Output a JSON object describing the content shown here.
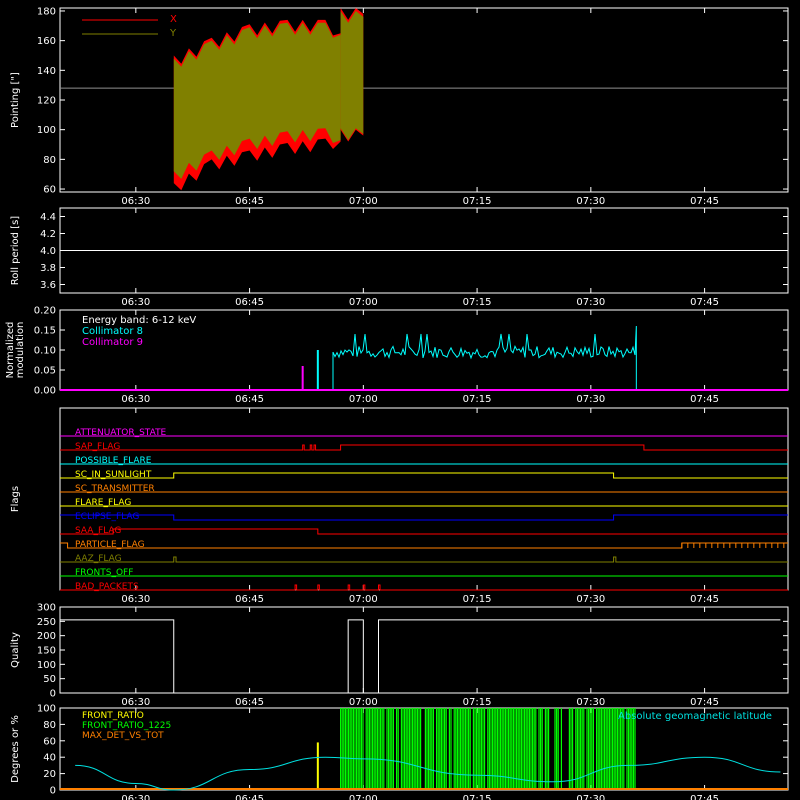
{
  "colors": {
    "background": "#000000",
    "axis": "#ffffff",
    "x_series": "#ff0000",
    "y_series": "#808000",
    "collimator8": "#00ffff",
    "collimator9": "#ff00ff",
    "front_ratio": "#ffff00",
    "front_ratio_1225": "#00ff00",
    "max_det": "#ff8000",
    "geomag": "#00e0e0"
  },
  "time_ticks": [
    "06:30",
    "06:45",
    "07:00",
    "07:15",
    "07:30",
    "07:45"
  ],
  "chart_data": [
    {
      "id": "pointing",
      "type": "area",
      "ylabel": "Pointing [\"]",
      "ylim": [
        58,
        182
      ],
      "yticks": [
        "60",
        "80",
        "100",
        "120",
        "140",
        "160",
        "180"
      ],
      "legend": {
        "position": "top-left",
        "entries": [
          "X",
          "Y"
        ]
      },
      "reference_line": 128,
      "series": [
        {
          "name": "X",
          "color": "#ff0000",
          "segments": [
            {
              "t": [
                "06:35",
                "06:40",
                "06:45",
                "06:50",
                "06:55",
                "06:57"
              ],
              "low": [
                60,
                76,
                82,
                87,
                90,
                92
              ],
              "high": [
                146,
                158,
                167,
                170,
                170,
                165
              ]
            },
            {
              "t": [
                "06:57",
                "07:00"
              ],
              "low": [
                96,
                96
              ],
              "high": [
                178,
                178
              ]
            }
          ]
        },
        {
          "name": "Y",
          "color": "#808000",
          "segments": [
            {
              "t": [
                "06:35",
                "06:40",
                "06:45",
                "06:50",
                "06:55",
                "06:57"
              ],
              "low": [
                68,
                82,
                90,
                95,
                97,
                93
              ],
              "high": [
                144,
                156,
                165,
                168,
                168,
                164
              ]
            },
            {
              "t": [
                "06:57",
                "07:00"
              ],
              "low": [
                97,
                97
              ],
              "high": [
                176,
                176
              ]
            }
          ]
        }
      ]
    },
    {
      "id": "roll",
      "type": "line",
      "ylabel": "Roll period [s]",
      "ylim": [
        3.5,
        4.5
      ],
      "yticks": [
        "3.6",
        "3.8",
        "4.0",
        "4.2",
        "4.4"
      ],
      "value": 4.0
    },
    {
      "id": "modulation",
      "type": "bar",
      "ylabel_lines": [
        "Normalized",
        "modulation"
      ],
      "ylim": [
        0,
        0.2
      ],
      "yticks": [
        "0.00",
        "0.05",
        "0.10",
        "0.15",
        "0.20"
      ],
      "annotations": [
        "Energy band: 6-12 keV",
        "Collimator 8",
        "Collimator 9"
      ],
      "spikes": [
        {
          "t": "06:52",
          "value": 0.06,
          "series": "Collimator 9"
        },
        {
          "t": "06:54",
          "value": 0.1,
          "series": "Collimator 8"
        }
      ],
      "band": {
        "series": "Collimator 8",
        "t_start": "06:56",
        "t_end": "07:36",
        "mean": 0.095,
        "spread": 0.015
      }
    },
    {
      "id": "flags",
      "type": "line",
      "ylabel": "Flags",
      "rows": [
        {
          "name": "ATTENUATOR_STATE",
          "color": "#ff00ff",
          "default": 0,
          "pulses": []
        },
        {
          "name": "SAP_FLAG",
          "color": "#ff0000",
          "default": 0,
          "pulses": [
            [
              "06:52",
              "06:52.2"
            ],
            [
              "06:53",
              "06:53.2"
            ],
            [
              "06:53.5",
              "06:53.7"
            ],
            [
              "06:57",
              "07:37"
            ]
          ],
          "invert_pulses": true
        },
        {
          "name": "POSSIBLE_FLARE",
          "color": "#00ffff",
          "default": 0,
          "pulses": []
        },
        {
          "name": "SC_IN_SUNLIGHT",
          "color": "#ffff00",
          "default": 0,
          "pulses": [
            [
              "06:35",
              "07:33"
            ]
          ]
        },
        {
          "name": "SC_TRANSMITTER",
          "color": "#ff8000",
          "default": 0,
          "pulses": []
        },
        {
          "name": "FLARE_FLAG",
          "color": "#ffff00",
          "default": 0,
          "pulses": []
        },
        {
          "name": "ECLIPSE_FLAG",
          "color": "#0000ff",
          "default": 1,
          "pulses": [
            [
              "06:35",
              "07:33"
            ]
          ],
          "invert_pulses": true
        },
        {
          "name": "SAA_FLAG",
          "color": "#ff0000",
          "default": 0,
          "pulses": [
            [
              "06:27",
              "06:54"
            ]
          ]
        },
        {
          "name": "PARTICLE_FLAG",
          "color": "#ff8000",
          "default": 1,
          "pulses": [
            [
              "06:21",
              "07:42"
            ]
          ],
          "invert_pulses": true
        },
        {
          "name": "AAZ_FLAG",
          "color": "#808000",
          "default": 0,
          "pulses": [
            [
              "06:35",
              "06:35.3"
            ],
            [
              "07:33",
              "07:33.3"
            ]
          ]
        },
        {
          "name": "FRONTS_OFF",
          "color": "#00ff00",
          "default": 0,
          "pulses": []
        },
        {
          "name": "BAD_PACKETS",
          "color": "#ff0000",
          "default": 0,
          "pulses": [
            [
              "06:51",
              "06:51.2"
            ],
            [
              "06:54",
              "06:54.2"
            ],
            [
              "06:58",
              "06:58.2"
            ],
            [
              "07:00",
              "07:00.2"
            ],
            [
              "07:02",
              "07:02.2"
            ]
          ]
        }
      ]
    },
    {
      "id": "quality",
      "type": "line",
      "ylabel": "Quality",
      "ylim": [
        0,
        300
      ],
      "yticks": [
        "0",
        "50",
        "100",
        "150",
        "200",
        "250",
        "300"
      ],
      "steps": [
        {
          "t": "06:22",
          "value": 255
        },
        {
          "t": "06:35",
          "value": 0
        },
        {
          "t": "06:58",
          "value": 255
        },
        {
          "t": "07:00",
          "value": 0
        },
        {
          "t": "07:02",
          "value": 255
        },
        {
          "t": "07:55",
          "value": 255
        }
      ]
    },
    {
      "id": "ratios",
      "type": "line",
      "ylabel": "Degrees or %",
      "ylim": [
        0,
        100
      ],
      "yticks": [
        "0",
        "20",
        "40",
        "60",
        "80",
        "100"
      ],
      "legend": {
        "position": "top-left",
        "entries": [
          "FRONT_RATIO",
          "FRONT_RATIO_1225",
          "MAX_DET_VS_TOT"
        ]
      },
      "annotation": "Absolute geomagnetic latitude",
      "front_ratio_spike": {
        "t": "06:54",
        "value": 58
      },
      "front_ratio_1225_band": {
        "t_start": "06:57",
        "t_end": "07:36",
        "value": 100
      },
      "geomag": {
        "t": [
          "06:22",
          "06:30",
          "06:35",
          "06:45",
          "06:55",
          "07:00",
          "07:15",
          "07:25",
          "07:35",
          "07:45",
          "07:55"
        ],
        "value": [
          30,
          8,
          0,
          25,
          40,
          38,
          18,
          10,
          30,
          40,
          22
        ]
      }
    }
  ]
}
